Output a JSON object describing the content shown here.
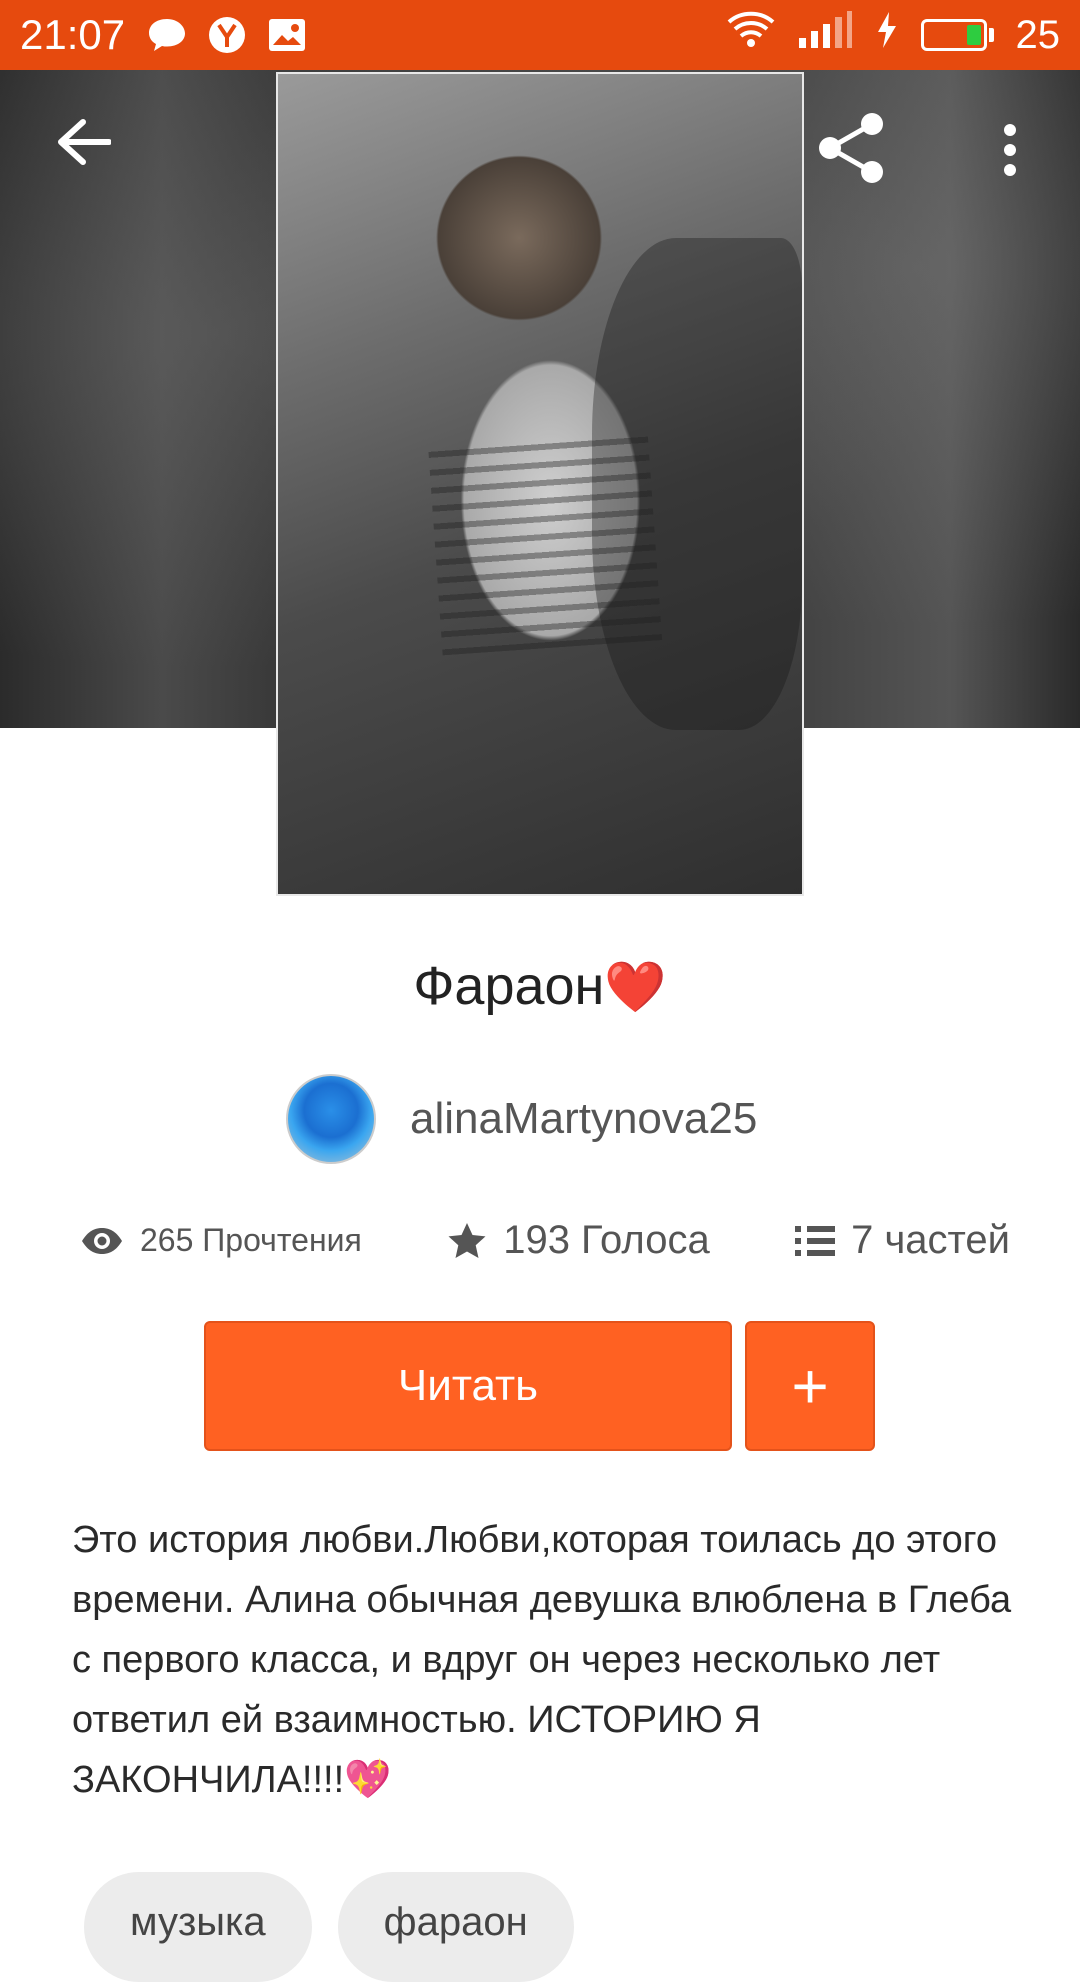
{
  "status_bar": {
    "time": "21:07",
    "battery_level": "25",
    "icons": [
      "chat-bubble-icon",
      "yandex-icon",
      "image-icon",
      "wifi-icon",
      "signal-icon",
      "charging-icon",
      "battery-icon"
    ],
    "accent_color": "#e64a0e"
  },
  "header": {
    "back_icon": "arrow-left-icon",
    "share_icon": "share-icon",
    "more_icon": "more-vertical-icon"
  },
  "story": {
    "title": "Фараон",
    "title_emoji": "❤️",
    "author": "alinaMartynova25",
    "stats": {
      "reads": "265 Прочтения",
      "votes": "193 Голоса",
      "parts": "7 частей"
    },
    "read_button": "Читать",
    "add_button": "+",
    "description": "Это история любви.Любви,которая тоилась до этого времени. Алина обычная девушка влюблена в Глеба с первого класса, и вдруг он через несколько лет ответил ей взаимностью. ИСТОРИЮ Я ЗАКОНЧИЛА!!!!",
    "description_emoji": "💖",
    "tags": [
      "музыка",
      "фараон"
    ]
  },
  "colors": {
    "button": "#ff6122",
    "tag_bg": "#ececec"
  }
}
